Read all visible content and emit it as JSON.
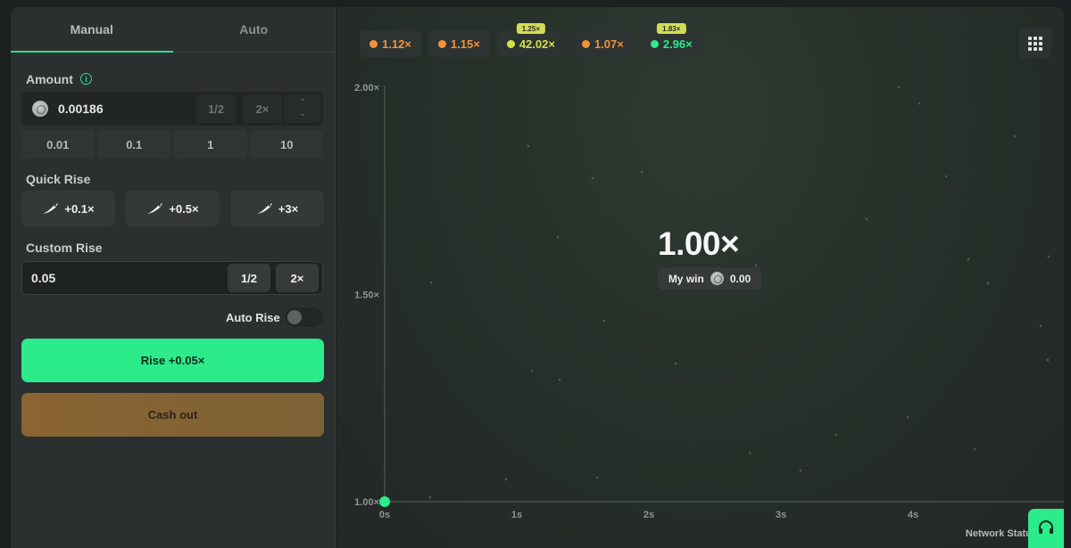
{
  "tabs": {
    "manual": "Manual",
    "auto": "Auto"
  },
  "amount": {
    "label": "Amount",
    "value": "0.00186",
    "half_label": "1/2",
    "double_label": "2×",
    "presets": [
      "0.01",
      "0.1",
      "1",
      "10"
    ]
  },
  "quick_rise": {
    "label": "Quick Rise",
    "buttons": [
      "+0.1×",
      "+0.5×",
      "+3×"
    ]
  },
  "custom_rise": {
    "label": "Custom Rise",
    "value": "0.05",
    "half_label": "1/2",
    "double_label": "2×"
  },
  "auto_rise": {
    "label": "Auto Rise",
    "enabled": false
  },
  "actions": {
    "rise_label": "Rise +0.05×",
    "cashout_label": "Cash out"
  },
  "history": [
    {
      "value": "1.12×",
      "color": "#f3923a",
      "badge": ""
    },
    {
      "value": "1.15×",
      "color": "#f3923a",
      "badge": ""
    },
    {
      "value": "42.02×",
      "color": "#d5e34a",
      "badge": "1.25×"
    },
    {
      "value": "1.07×",
      "color": "#f3923a",
      "badge": ""
    },
    {
      "value": "2.96×",
      "color": "#2ceb8a",
      "badge": "1.83×"
    }
  ],
  "game": {
    "multiplier": "1.00×",
    "my_win_label": "My win",
    "my_win_value": "0.00",
    "network_status": "Network Status"
  },
  "chart_data": {
    "type": "line",
    "x_ticks": [
      "0s",
      "1s",
      "2s",
      "3s",
      "4s"
    ],
    "y_ticks": [
      "1.00×",
      "1.50×",
      "2.00×"
    ],
    "xlim": [
      0,
      5
    ],
    "ylim": [
      1.0,
      2.0
    ],
    "series": [
      {
        "x": [
          0
        ],
        "y": [
          1.0
        ]
      }
    ],
    "grid": false
  },
  "colors": {
    "accent": "#2ceb8a",
    "cashout": "#8a6432",
    "orange": "#f3923a",
    "yellow": "#d5e34a"
  }
}
